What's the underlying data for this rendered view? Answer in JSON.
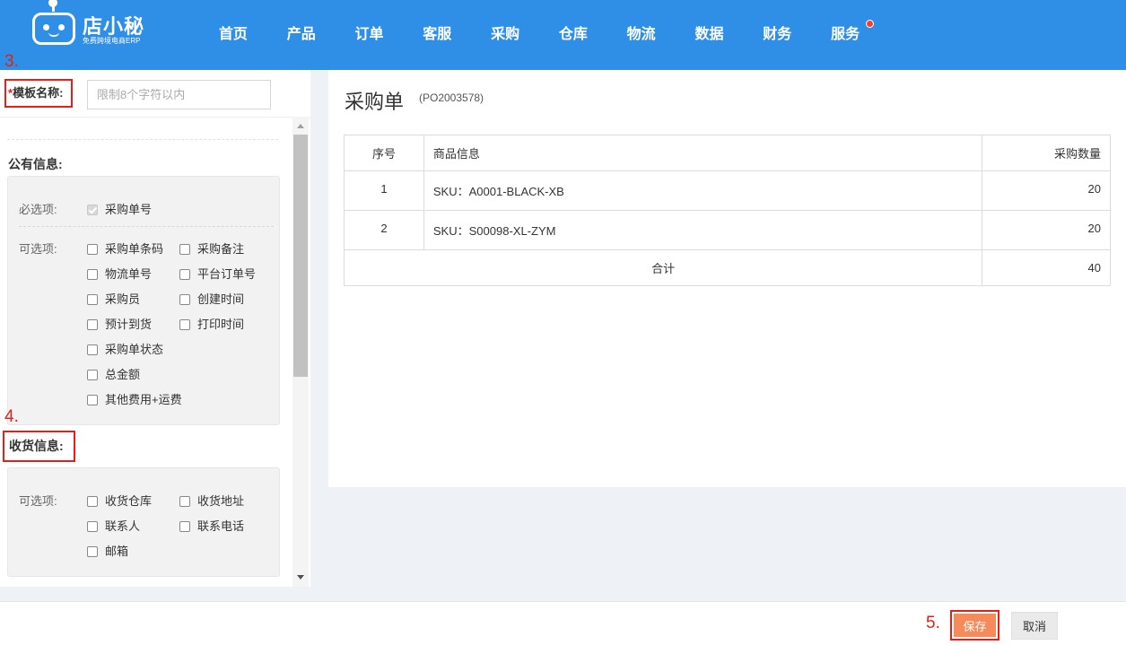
{
  "app": {
    "logo_title": "店小秘",
    "logo_sub": "免费跨境电商ERP"
  },
  "nav": {
    "items": [
      "首页",
      "产品",
      "订单",
      "客服",
      "采购",
      "仓库",
      "物流",
      "数据",
      "财务",
      "服务"
    ]
  },
  "steps": {
    "s3": "3.",
    "s4": "4.",
    "s5": "5."
  },
  "template": {
    "name_label": "模板名称:",
    "name_required": "*",
    "name_placeholder": "限制8个字符以内"
  },
  "public_info": {
    "title": "公有信息:",
    "required_label": "必选项:",
    "required_item": "采购单号",
    "optional_label": "可选项:",
    "optional_items": [
      "采购单条码",
      "采购备注",
      "物流单号",
      "平台订单号",
      "采购员",
      "创建时间",
      "预计到货",
      "打印时间",
      "采购单状态",
      "总金额",
      "其他费用+运费"
    ]
  },
  "receive_info": {
    "title": "收货信息:",
    "optional_label": "可选项:",
    "optional_items": [
      "收货仓库",
      "收货地址",
      "联系人",
      "联系电话",
      "邮箱"
    ]
  },
  "preview": {
    "title": "采购单",
    "code": "(PO2003578)",
    "headers": {
      "seq": "序号",
      "info": "商品信息",
      "qty": "采购数量"
    },
    "rows": [
      {
        "seq": "1",
        "info": "SKU：A0001-BLACK-XB",
        "qty": "20"
      },
      {
        "seq": "2",
        "info": "SKU：S00098-XL-ZYM",
        "qty": "20"
      }
    ],
    "total_label": "合计",
    "total_qty": "40"
  },
  "footer": {
    "save": "保存",
    "cancel": "取消"
  },
  "colors": {
    "nav_bg": "#2f8fe6",
    "save_bg": "#f58b5b",
    "annotation": "#e0201a"
  }
}
